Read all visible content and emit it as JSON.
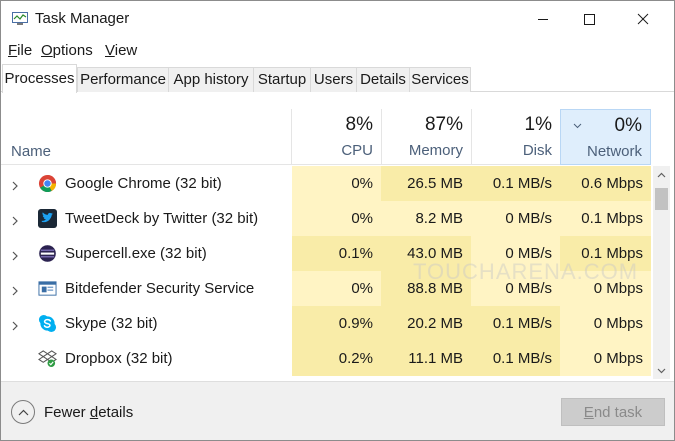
{
  "window": {
    "title": "Task Manager"
  },
  "menu": [
    {
      "first": "F",
      "rest": "ile"
    },
    {
      "first": "O",
      "rest": "ptions"
    },
    {
      "first": "V",
      "rest": "iew"
    }
  ],
  "tabs": [
    "Processes",
    "Performance",
    "App history",
    "Startup",
    "Users",
    "Details",
    "Services"
  ],
  "active_tab": "Processes",
  "columns": {
    "name": "Name",
    "cpu": {
      "pct": "8%",
      "label": "CPU"
    },
    "memory": {
      "pct": "87%",
      "label": "Memory"
    },
    "disk": {
      "pct": "1%",
      "label": "Disk"
    },
    "network": {
      "pct": "0%",
      "label": "Network"
    }
  },
  "sorted_column": "Network",
  "processes": [
    {
      "name": "Google Chrome (32 bit)",
      "icon": "chrome-icon",
      "cpu": "0%",
      "memory": "26.5 MB",
      "disk": "0.1 MB/s",
      "network": "0.6 Mbps",
      "expandable": true
    },
    {
      "name": "TweetDeck by Twitter (32 bit)",
      "icon": "tweetdeck-icon",
      "cpu": "0%",
      "memory": "8.2 MB",
      "disk": "0 MB/s",
      "network": "0.1 Mbps",
      "expandable": true
    },
    {
      "name": "Supercell.exe (32 bit)",
      "icon": "supercell-icon",
      "cpu": "0.1%",
      "memory": "43.0 MB",
      "disk": "0 MB/s",
      "network": "0.1 Mbps",
      "expandable": true
    },
    {
      "name": "Bitdefender Security Service",
      "icon": "bitdefender-icon",
      "cpu": "0%",
      "memory": "88.8 MB",
      "disk": "0 MB/s",
      "network": "0 Mbps",
      "expandable": true
    },
    {
      "name": "Skype (32 bit)",
      "icon": "skype-icon",
      "cpu": "0.9%",
      "memory": "20.2 MB",
      "disk": "0.1 MB/s",
      "network": "0 Mbps",
      "expandable": true
    },
    {
      "name": "Dropbox (32 bit)",
      "icon": "dropbox-icon",
      "cpu": "0.2%",
      "memory": "11.1 MB",
      "disk": "0.1 MB/s",
      "network": "0 Mbps",
      "expandable": false
    }
  ],
  "watermark": "TOUCHARENA.COM",
  "footer": {
    "fewer_details": {
      "before": "Fewer ",
      "underlined": "d",
      "after": "etails"
    },
    "end_task": {
      "underlined": "E",
      "after": "nd task"
    }
  },
  "colors": {
    "heat_light": "#fff4c4",
    "heat_medium": "#f9eca8",
    "network_header": "#dfeefc",
    "header_label": "#4c607a"
  }
}
